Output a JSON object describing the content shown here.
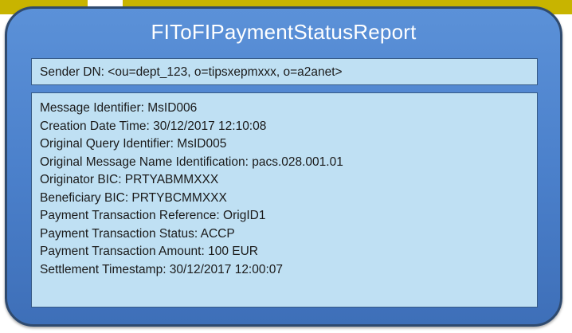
{
  "title": "FIToFIPaymentStatusReport",
  "sender": "Sender DN: <ou=dept_123, o=tipsxepmxxx, o=a2anet>",
  "fields": [
    "Message Identifier: MsID006",
    "Creation Date Time: 30/12/2017 12:10:08",
    "Original Query Identifier: MsID005",
    "Original Message Name Identification: pacs.028.001.01",
    "Originator BIC: PRTYABMMXXX",
    "Beneficiary BIC: PRTYBCMMXXX",
    "Payment Transaction Reference: OrigID1",
    "Payment Transaction Status: ACCP",
    "Payment Transaction Amount: 100 EUR",
    "Settlement Timestamp: 30/12/2017 12:00:07"
  ],
  "colors": {
    "card_fill": "#4a7fca",
    "card_border": "#2f4a6e",
    "panel_fill": "#bfe0f3",
    "top_strip": "#c8b400"
  }
}
